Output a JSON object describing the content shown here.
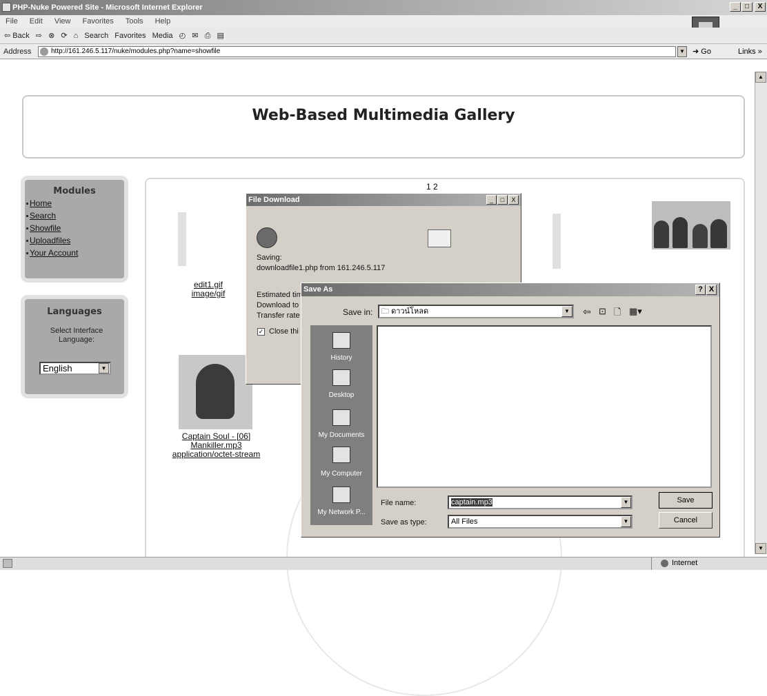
{
  "window": {
    "title": "PHP-Nuke Powered Site - Microsoft Internet Explorer",
    "min": "_",
    "max": "□",
    "close": "X"
  },
  "menu": [
    "File",
    "Edit",
    "View",
    "Favorites",
    "Tools",
    "Help"
  ],
  "toolbar": {
    "back": "⇦ Back",
    "forward": "⇨",
    "stop": "⊗",
    "refresh": "⟳",
    "home": "⌂",
    "search": "Search",
    "favorites": "Favorites",
    "media": "Media",
    "history": "◴",
    "mail": "✉",
    "print": "⎙",
    "edit": "▤"
  },
  "address": {
    "label": "Address",
    "url": "http://161.246.5.117/nuke/modules.php?name=showfile",
    "go": "Go",
    "links": "Links »"
  },
  "page": {
    "title": "Web-Based Multimedia Gallery",
    "modules": {
      "title": "Modules",
      "items": [
        "Home",
        "Search",
        "Showfile",
        "Uploadfiles",
        "Your Account"
      ]
    },
    "languages": {
      "title": "Languages",
      "prompt_line1": "Select Interface",
      "prompt_line2": "Language:",
      "selected": "English"
    },
    "pagination": "1 2",
    "items": [
      {
        "name": "edit1.gif",
        "type": "image/gif"
      },
      {
        "name_line1": "Captain Soul - [06]",
        "name_line2": "Mankiller.mp3",
        "type": "application/octet-stream"
      }
    ]
  },
  "file_download": {
    "title": "File Download",
    "saving": "Saving:",
    "file_from": "downloadfile1.php from 161.246.5.117",
    "estimated": "Estimated tim",
    "download_to": "Download to",
    "transfer_rate": "Transfer rate",
    "close_this": "Close thi"
  },
  "save_as": {
    "title": "Save As",
    "help_btn": "?",
    "close_btn": "X",
    "save_in_label": "Save in:",
    "save_in_value": "ดาวน์โหลด",
    "places": [
      "History",
      "Desktop",
      "My Documents",
      "My Computer",
      "My Network P..."
    ],
    "file_name_label": "File name:",
    "file_name_value": "captain.mp3",
    "save_type_label": "Save as type:",
    "save_type_value": "All Files",
    "save_button": "Save",
    "cancel_button": "Cancel"
  },
  "status": {
    "zone": "Internet"
  }
}
